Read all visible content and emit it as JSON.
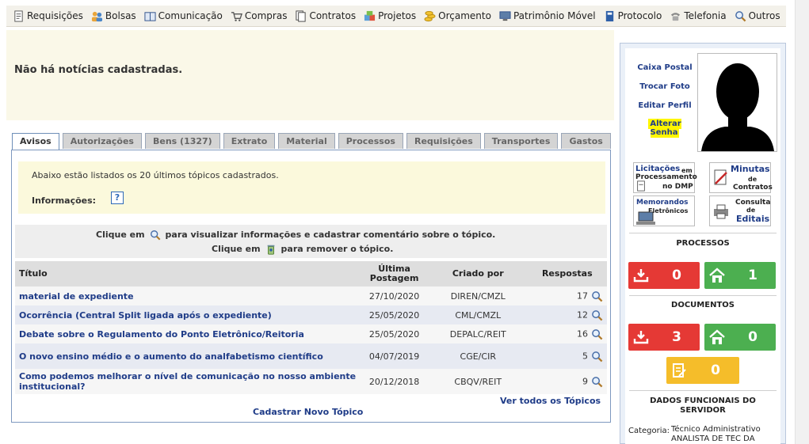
{
  "menu": [
    {
      "label": "Requisições",
      "icon": "document-icon"
    },
    {
      "label": "Bolsas",
      "icon": "people-icon"
    },
    {
      "label": "Comunicação",
      "icon": "book-icon"
    },
    {
      "label": "Compras",
      "icon": "cart-icon"
    },
    {
      "label": "Contratos",
      "icon": "pages-icon"
    },
    {
      "label": "Projetos",
      "icon": "puzzle-icon"
    },
    {
      "label": "Orçamento",
      "icon": "coins-icon"
    },
    {
      "label": "Patrimônio Móvel",
      "icon": "computer-icon"
    },
    {
      "label": "Protocolo",
      "icon": "binder-icon"
    },
    {
      "label": "Telefonia",
      "icon": "telephone-icon"
    },
    {
      "label": "Outros",
      "icon": "search-icon"
    }
  ],
  "news": {
    "message": "Não há notícias cadastradas."
  },
  "tabs": [
    {
      "label": "Avisos",
      "active": true
    },
    {
      "label": "Autorizações"
    },
    {
      "label": "Bens (1327)"
    },
    {
      "label": "Extrato"
    },
    {
      "label": "Material"
    },
    {
      "label": "Processos"
    },
    {
      "label": "Requisições"
    },
    {
      "label": "Transportes"
    },
    {
      "label": "Gastos"
    }
  ],
  "info": {
    "text": "Abaixo estão listados os 20 últimos tópicos cadastrados.",
    "label": "Informações:",
    "help": "?"
  },
  "legend": {
    "line1_pre": "Clique em",
    "line1_post": "para visualizar informações e cadastrar comentário sobre o tópico.",
    "line2_pre": "Clique em",
    "line2_post": "para remover o tópico."
  },
  "table": {
    "headers": {
      "title": "Título",
      "last": "Última Postagem",
      "created": "Criado por",
      "replies": "Respostas"
    },
    "rows": [
      {
        "title": "material de expediente",
        "last": "27/10/2020",
        "created": "DIREN/CMZL",
        "replies": "17"
      },
      {
        "title": "Ocorrência (Central Split ligada após o expediente)",
        "last": "25/05/2020",
        "created": "CML/CMZL",
        "replies": "12"
      },
      {
        "title": "Debate sobre o Regulamento do Ponto Eletrônico/Reitoria",
        "last": "25/05/2020",
        "created": "DEPALC/REIT",
        "replies": "16"
      },
      {
        "title": "O novo ensino médio e o aumento do analfabetismo científico",
        "last": "04/07/2019",
        "created": "CGE/CIR",
        "replies": "5"
      },
      {
        "title": "Como podemos melhorar o nível de comunicação no nosso ambiente institucional?",
        "last": "20/12/2018",
        "created": "CBQV/REIT",
        "replies": "9"
      }
    ]
  },
  "links": {
    "all_topics": "Ver todos os Tópicos",
    "new_topic": "Cadastrar Novo Tópico"
  },
  "profile": {
    "mailbox": "Caixa Postal",
    "change_photo": "Trocar Foto",
    "edit_profile": "Editar Perfil",
    "change_password": "Alterar Senha"
  },
  "quick_links": {
    "licitacoes": {
      "line1": "Licitações",
      "line1b": "em",
      "line2": "Processamento",
      "line3": "no DMP"
    },
    "minutas": {
      "line1": "Minutas",
      "line2": "de",
      "line3": "Contratos"
    },
    "memorandos": {
      "line1": "Memorandos",
      "line2": "Eletrônicos"
    },
    "editais": {
      "line1": "Consulta",
      "line2": "de",
      "line3": "Editais"
    }
  },
  "processos": {
    "title": "PROCESSOS",
    "inbox": "0",
    "home": "1"
  },
  "documentos": {
    "title": "DOCUMENTOS",
    "inbox": "3",
    "home": "0",
    "pending": "0"
  },
  "dados": {
    "title": "DADOS FUNCIONAIS DO SERVIDOR",
    "categoria_label": "Categoria:",
    "categoria_value": "Técnico Administrativo",
    "cargo_value": "ANALISTA DE TEC DA"
  },
  "colors": {
    "accent": "#1f3c88",
    "red": "#e53935",
    "green": "#4caf50",
    "yellow": "#f5bd2a",
    "highlight": "#fff600"
  }
}
